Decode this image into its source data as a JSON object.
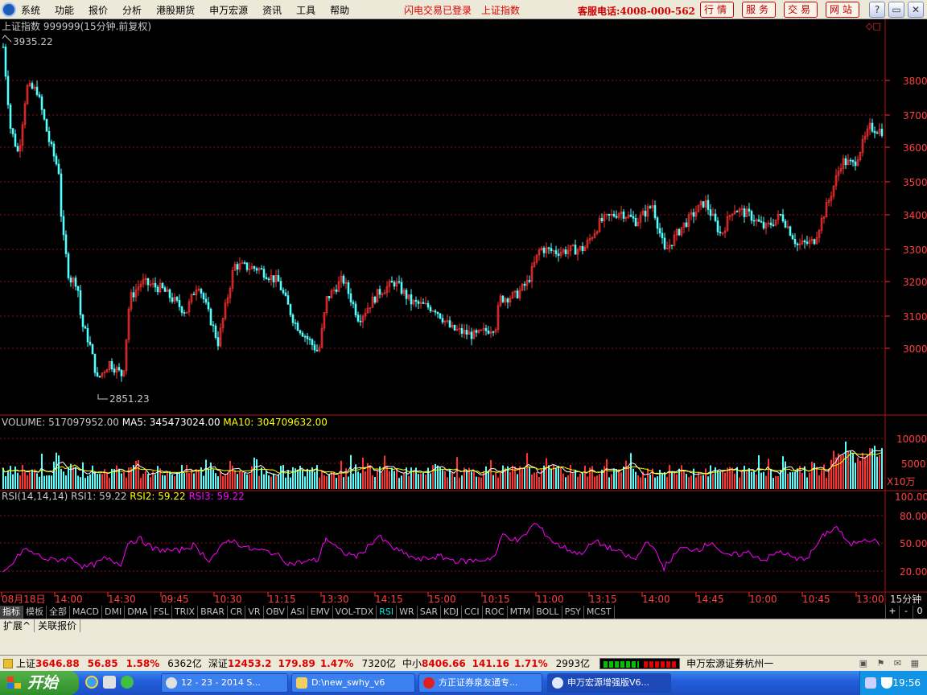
{
  "menubar": {
    "items": [
      "系统",
      "功能",
      "报价",
      "分析",
      "港股期货",
      "申万宏源",
      "资讯",
      "工具",
      "帮助"
    ],
    "notice1": "闪电交易已登录",
    "notice2": "上证指数",
    "phone": "客服电话:4008-000-562",
    "buttons": [
      "行情",
      "服务",
      "交易",
      "网站"
    ],
    "window_icons": [
      "help-icon",
      "minimize-icon",
      "restore-icon",
      "close-icon"
    ]
  },
  "chart": {
    "title": "上证指数 999999(15分钟.前复权)",
    "high_label": "3935.22",
    "low_label": "2851.23",
    "price_axis": [
      "3800",
      "3700",
      "3600",
      "3500",
      "3400",
      "3300",
      "3200",
      "3100",
      "3000"
    ],
    "volume_header": {
      "vol": "VOLUME: 517097952.00",
      "ma5": "MA5: 345473024.00",
      "ma10": "MA10: 304709632.00"
    },
    "volume_axis": [
      "10000",
      "5000"
    ],
    "volume_unit": "X10万",
    "rsi_header": {
      "name": "RSI(14,14,14)",
      "rsi1": "RSI1: 59.22",
      "rsi2": "RSI2: 59.22",
      "rsi3": "RSI3: 59.22"
    },
    "rsi_axis": [
      "100.00",
      "80.00",
      "50.00",
      "20.00"
    ],
    "time_axis": [
      "08月18日",
      "14:00",
      "14:30",
      "09:45",
      "10:30",
      "11:15",
      "13:30",
      "14:15",
      "15:00",
      "10:15",
      "11:00",
      "13:15",
      "14:00",
      "14:45",
      "10:00",
      "10:45",
      "13:00"
    ],
    "period": "15分钟",
    "colors": {
      "up": "#ff3232",
      "down": "#54ffff",
      "grid": "#8c1212",
      "ma5": "#ffffff",
      "ma10": "#ffff00",
      "rsi": "#ff00ff"
    }
  },
  "indicator_tabs": [
    "指标",
    "模板",
    "全部",
    "MACD",
    "DMI",
    "DMA",
    "FSL",
    "TRIX",
    "BRAR",
    "CR",
    "VR",
    "OBV",
    "ASI",
    "EMV",
    "VOL-TDX",
    "RSI",
    "WR",
    "SAR",
    "KDJ",
    "CCI",
    "ROC",
    "MTM",
    "BOLL",
    "PSY",
    "MCST"
  ],
  "active_indicator": "RSI",
  "scroll_controls": [
    "+",
    "-",
    "0"
  ],
  "bottom_tabs": [
    "扩展^",
    "关联报价"
  ],
  "status": {
    "sh_name": "上证",
    "sh_val": "3646.88",
    "sh_chg": "56.85",
    "sh_pct": "1.58%",
    "sh_amt": "6362亿",
    "sz_name": "深证",
    "sz_val": "12453.2",
    "sz_chg": "179.89",
    "sz_pct": "1.47%",
    "sz_amt": "7320亿",
    "zx_name": "中小",
    "zx_val": "8406.66",
    "zx_chg": "141.16",
    "zx_pct": "1.71%",
    "zx_amt": "2993亿",
    "broker": "申万宏源证券杭州一"
  },
  "taskbar": {
    "start": "开始",
    "tasks": [
      "12 - 23 - 2014 S...",
      "D:\\new_swhy_v6",
      "方正证券泉友通专...",
      "申万宏源增强版V6..."
    ],
    "clock": "19:56"
  }
}
